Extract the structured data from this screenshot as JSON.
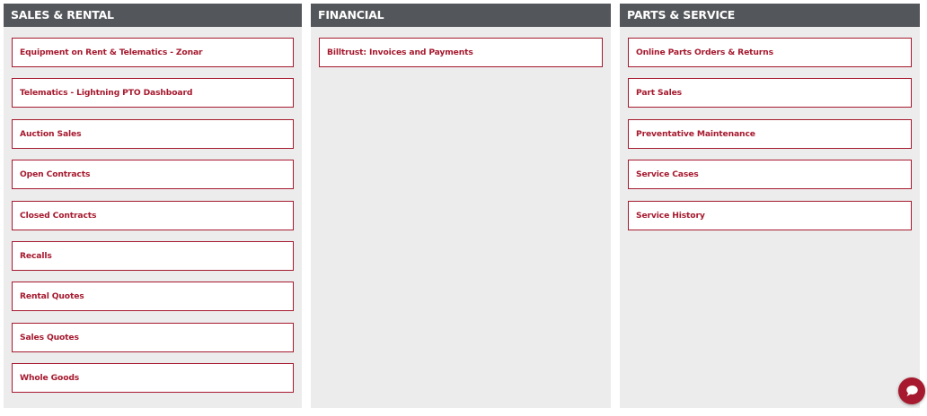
{
  "colors": {
    "header_bg": "#53565a",
    "panel_bg": "#ececec",
    "accent": "#a6192e"
  },
  "columns": [
    {
      "title": "SALES & RENTAL",
      "items": [
        "Equipment on Rent & Telematics - Zonar",
        "Telematics - Lightning PTO Dashboard",
        "Auction Sales",
        "Open Contracts",
        "Closed Contracts",
        "Recalls",
        "Rental Quotes",
        "Sales Quotes",
        "Whole Goods"
      ]
    },
    {
      "title": "FINANCIAL",
      "items": [
        "Billtrust: Invoices and Payments"
      ]
    },
    {
      "title": "PARTS & SERVICE",
      "items": [
        "Online Parts Orders & Returns",
        "Part Sales",
        "Preventative Maintenance",
        "Service Cases",
        "Service History"
      ]
    }
  ],
  "chat": {
    "icon": "chat-bubble-icon"
  }
}
